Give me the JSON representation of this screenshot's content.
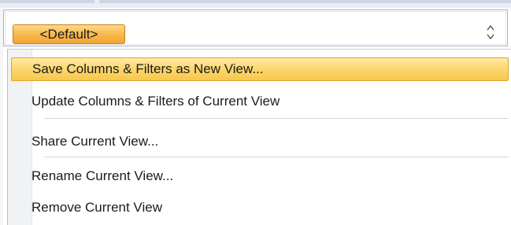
{
  "combo": {
    "selected_value": "<Default>",
    "spinner_icon": "up-down-arrows-icon"
  },
  "menu": {
    "items": [
      {
        "label": "Save Columns & Filters as New View...",
        "highlighted": true
      },
      {
        "label": "Update Columns & Filters of Current View",
        "highlighted": false
      },
      {
        "label": "Share Current View...",
        "highlighted": false
      },
      {
        "label": "Rename Current View...",
        "highlighted": false
      },
      {
        "label": "Remove Current View",
        "highlighted": false
      }
    ]
  },
  "colors": {
    "highlight": "#fcd66c",
    "chip": "#f6b649"
  }
}
